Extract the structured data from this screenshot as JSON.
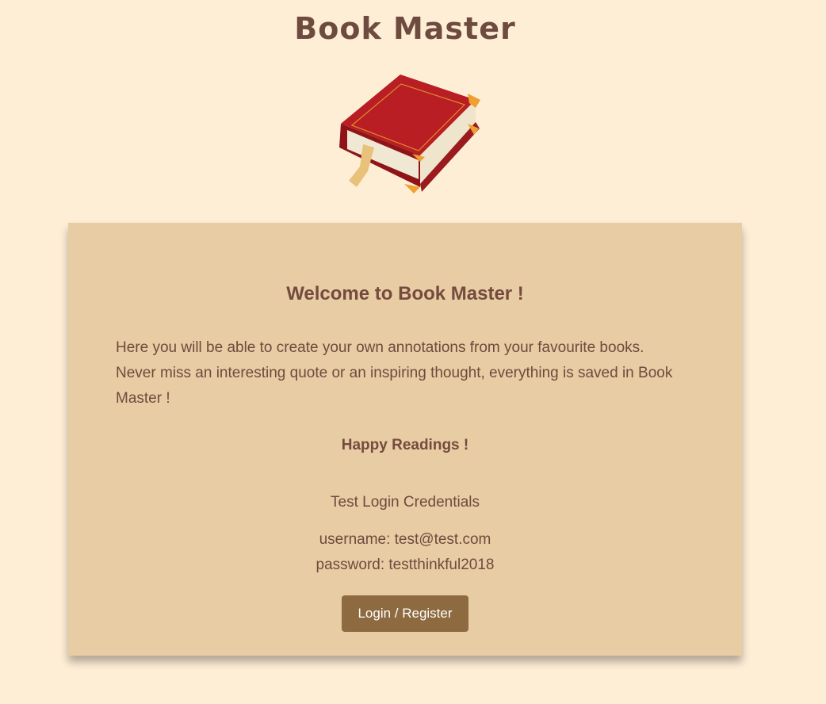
{
  "header": {
    "title": "Book Master",
    "logo_icon": "book-icon"
  },
  "card": {
    "heading": "Welcome to Book Master !",
    "intro": "Here you will be able to create your own annotations from your favourite books. Never miss an interesting quote or an inspiring thought, everything is saved in Book Master !",
    "happy": "Happy Readings !",
    "credentials_title": "Test Login Credentials",
    "username_line": "username: test@test.com",
    "password_line": "password: testthinkful2018",
    "login_button": "Login / Register"
  },
  "colors": {
    "background": "#ffeed6",
    "card": "#e8cca3",
    "text": "#6e4b3f",
    "button": "#8d6a3f"
  }
}
